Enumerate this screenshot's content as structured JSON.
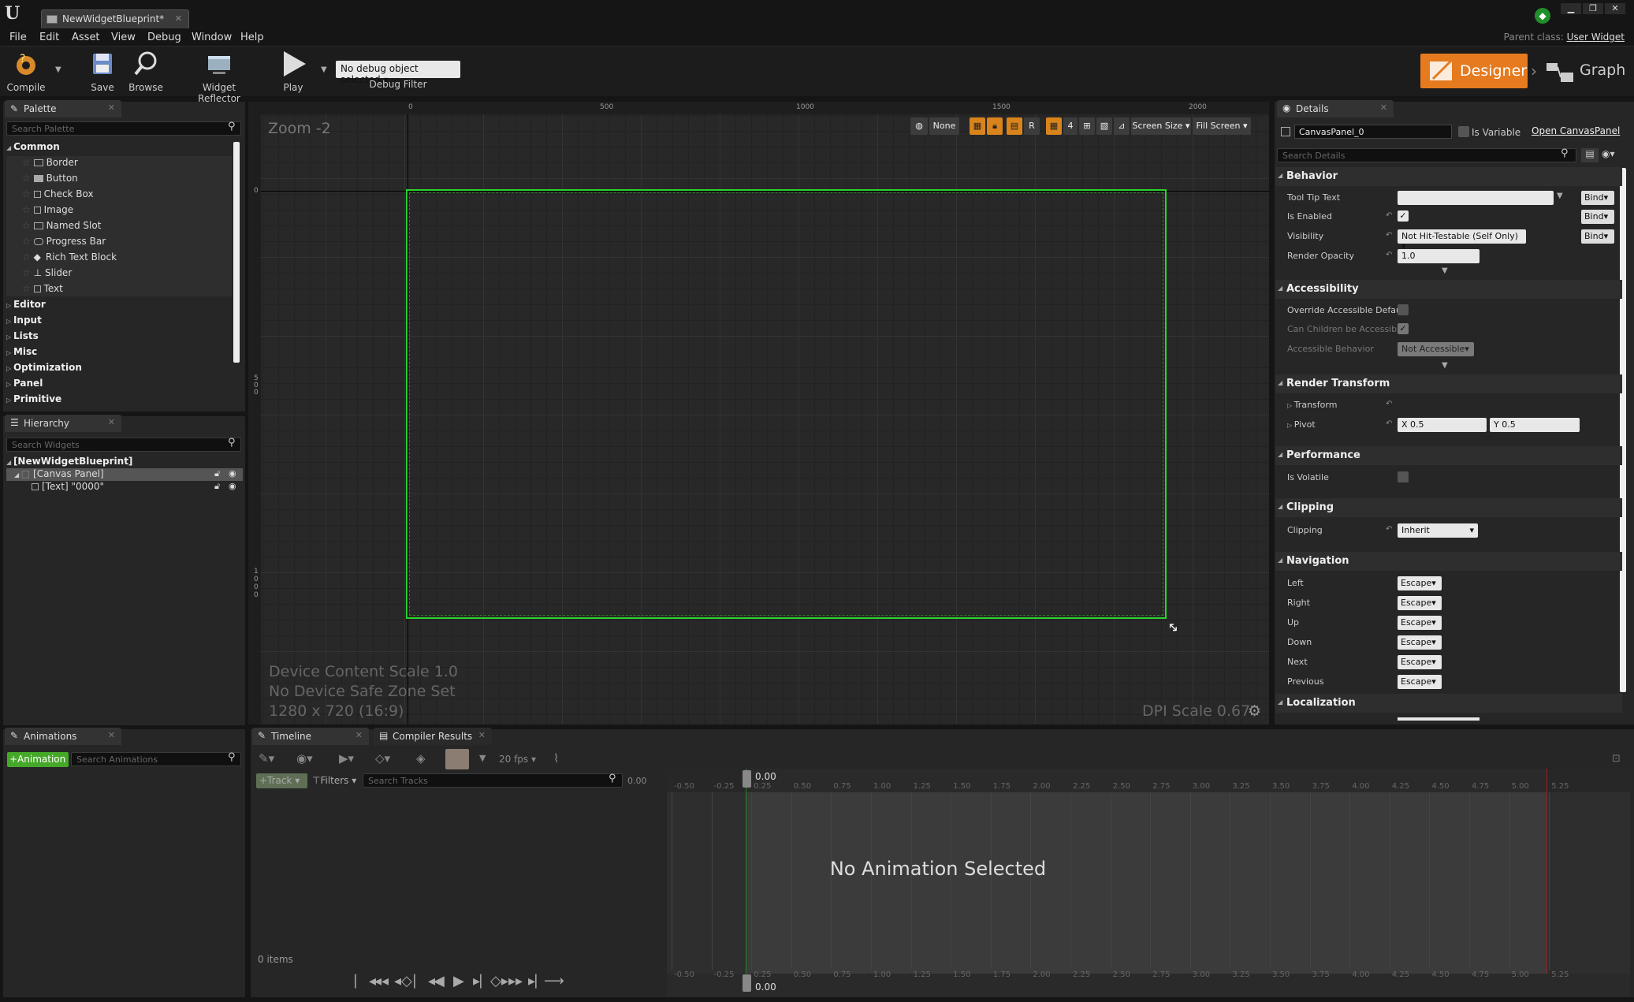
{
  "window": {
    "tab_title": "NewWidgetBlueprint*",
    "tab_close": "✕",
    "min": "▁",
    "restore": "❐",
    "close": "✕"
  },
  "menu": {
    "items": [
      "File",
      "Edit",
      "Asset",
      "View",
      "Debug",
      "Window",
      "Help"
    ],
    "parent_class_label": "Parent class:",
    "parent_class_value": "User Widget"
  },
  "toolbar": {
    "compile": "Compile",
    "save": "Save",
    "browse": "Browse",
    "widget_reflector": "Widget Reflector",
    "play": "Play",
    "debug_select": "No debug object selected",
    "debug_filter": "Debug Filter",
    "designer": "Designer",
    "graph": "Graph"
  },
  "palette": {
    "tab": "Palette",
    "search_placeholder": "Search Palette",
    "category_open": "Common",
    "common_items": [
      "Border",
      "Button",
      "Check Box",
      "Image",
      "Named Slot",
      "Progress Bar",
      "Rich Text Block",
      "Slider",
      "Text"
    ],
    "categories": [
      "Editor",
      "Input",
      "Lists",
      "Misc",
      "Optimization",
      "Panel",
      "Primitive"
    ]
  },
  "hierarchy": {
    "tab": "Hierarchy",
    "search_placeholder": "Search Widgets",
    "root": "[NewWidgetBlueprint]",
    "canvas": "[Canvas Panel]",
    "text": "[Text] \"0000\""
  },
  "viewport": {
    "zoom": "Zoom -2",
    "ruler_top": [
      "0",
      "500",
      "1000",
      "1500",
      "2000"
    ],
    "ruler_left": [
      "0",
      "5\n0\n0",
      "1\n0\n0\n0"
    ],
    "vp_buttons": {
      "none": "None",
      "r": "R",
      "four": "4",
      "screen_size": "Screen Size",
      "fill_screen": "Fill Screen"
    },
    "info_line1": "Device Content Scale 1.0",
    "info_line2": "No Device Safe Zone Set",
    "info_line3": "1280 x 720 (16:9)",
    "dpi": "DPI Scale 0.67"
  },
  "details": {
    "tab": "Details",
    "name_value": "CanvasPanel_0",
    "is_variable": "Is Variable",
    "open_link": "Open CanvasPanel",
    "search_placeholder": "Search Details",
    "sections": {
      "behavior": "Behavior",
      "accessibility": "Accessibility",
      "render_transform": "Render Transform",
      "performance": "Performance",
      "clipping": "Clipping",
      "navigation": "Navigation",
      "localization": "Localization"
    },
    "props": {
      "tooltip": "Tool Tip Text",
      "is_enabled": "Is Enabled",
      "visibility": "Visibility",
      "visibility_value": "Not Hit-Testable (Self Only)",
      "render_opacity": "Render Opacity",
      "render_opacity_value": "1.0",
      "override_accessible": "Override Accessible Defaul",
      "can_children": "Can Children be Accessible",
      "accessible_behavior": "Accessible Behavior",
      "accessible_behavior_value": "Not Accessible",
      "transform": "Transform",
      "pivot": "Pivot",
      "pivot_x": "X  0.5",
      "pivot_y": "Y  0.5",
      "is_volatile": "Is Volatile",
      "clipping": "Clipping",
      "clipping_value": "Inherit",
      "bind": "Bind"
    },
    "navigation": [
      {
        "label": "Left",
        "value": "Escape"
      },
      {
        "label": "Right",
        "value": "Escape"
      },
      {
        "label": "Up",
        "value": "Escape"
      },
      {
        "label": "Down",
        "value": "Escape"
      },
      {
        "label": "Next",
        "value": "Escape"
      },
      {
        "label": "Previous",
        "value": "Escape"
      }
    ]
  },
  "animations": {
    "tab": "Animations",
    "add_button": "+Animation",
    "search_placeholder": "Search Animations"
  },
  "timeline": {
    "tab_timeline": "Timeline",
    "tab_compiler": "Compiler Results",
    "fps": "20 fps",
    "track": "+Track",
    "filters": "Filters",
    "search_placeholder": "Search Tracks",
    "time_value": "0.00",
    "playhead": "0.00",
    "no_animation": "No Animation Selected",
    "item_count": "0 items",
    "ticks": [
      "-0.50",
      "-0.25",
      "0.25",
      "0.50",
      "0.75",
      "1.00",
      "1.25",
      "1.50",
      "1.75",
      "2.00",
      "2.25",
      "2.50",
      "2.75",
      "3.00",
      "3.25",
      "3.50",
      "3.75",
      "4.00",
      "4.25",
      "4.50",
      "4.75",
      "5.00",
      "5.25"
    ]
  }
}
